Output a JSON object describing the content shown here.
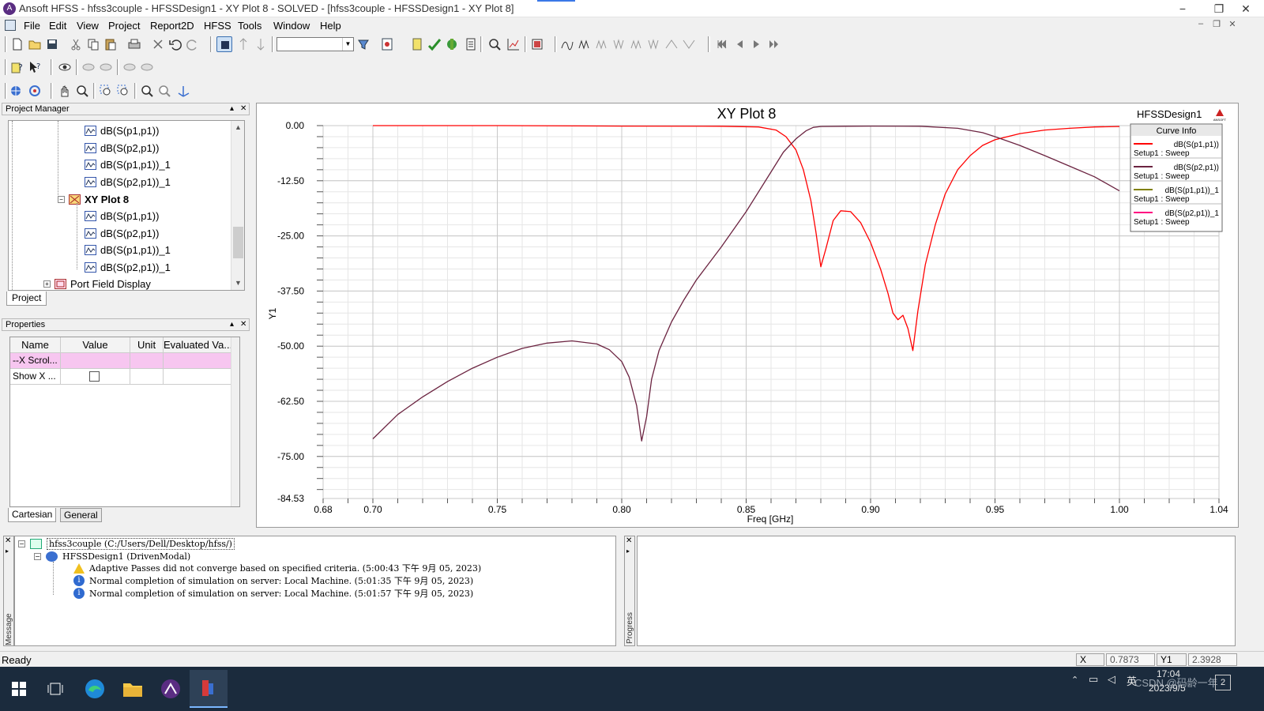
{
  "window": {
    "title": "Ansoft HFSS  - hfss3couple - HFSSDesign1 - XY Plot 8 - SOLVED - [hfss3couple - HFSSDesign1 - XY Plot 8]",
    "controls": [
      "−",
      "❐",
      "✕"
    ]
  },
  "menu": [
    "File",
    "Edit",
    "View",
    "Project",
    "Report2D",
    "HFSS",
    "Tools",
    "Window",
    "Help"
  ],
  "project_manager": {
    "title": "Project Manager",
    "items": [
      {
        "label": "dB(S(p1,p1))",
        "kind": "curve"
      },
      {
        "label": "dB(S(p2,p1))",
        "kind": "curve"
      },
      {
        "label": "dB(S(p1,p1))_1",
        "kind": "curve"
      },
      {
        "label": "dB(S(p2,p1))_1",
        "kind": "curve"
      },
      {
        "label": "XY Plot 8",
        "kind": "plot"
      },
      {
        "label": "dB(S(p1,p1))",
        "kind": "curve"
      },
      {
        "label": "dB(S(p2,p1))",
        "kind": "curve"
      },
      {
        "label": "dB(S(p1,p1))_1",
        "kind": "curve"
      },
      {
        "label": "dB(S(p2,p1))_1",
        "kind": "curve"
      },
      {
        "label": "Port Field Display",
        "kind": "folder"
      }
    ],
    "tab": "Project"
  },
  "properties": {
    "title": "Properties",
    "columns": [
      "Name",
      "Value",
      "Unit",
      "Evaluated Va..."
    ],
    "rows": [
      {
        "name": "--X Scrol...",
        "value": "",
        "unit": "",
        "evaluated": ""
      },
      {
        "name": "Show X ...",
        "value": "",
        "unit": "",
        "evaluated": ""
      }
    ],
    "tabs": [
      "Cartesian",
      "General"
    ]
  },
  "plot": {
    "design_label": "HFSSDesign1",
    "logo_text": "ANSOFT",
    "legend_title": "Curve Info"
  },
  "chart_data": {
    "type": "line",
    "title": "XY Plot 8",
    "xlabel": "Freq [GHz]",
    "ylabel": "Y1",
    "xlim": [
      0.68,
      1.04
    ],
    "ylim": [
      -84.53,
      0.0
    ],
    "x_ticks": [
      "0.68",
      "0.70",
      "0.75",
      "0.80",
      "0.85",
      "0.90",
      "0.95",
      "1.00",
      "1.04"
    ],
    "y_ticks": [
      "0.00",
      "-12.50",
      "-25.00",
      "-37.50",
      "-50.00",
      "-62.50",
      "-75.00",
      "-84.53"
    ],
    "grid": true,
    "legend_position": "top-right",
    "series": [
      {
        "name": "dB(S(p1,p1))",
        "sub": "Setup1 : Sweep",
        "color": "#ff0000",
        "x": [
          0.7,
          0.75,
          0.8,
          0.84,
          0.855,
          0.862,
          0.866,
          0.87,
          0.873,
          0.876,
          0.878,
          0.88,
          0.882,
          0.885,
          0.888,
          0.892,
          0.896,
          0.9,
          0.904,
          0.907,
          0.909,
          0.911,
          0.913,
          0.915,
          0.917,
          0.919,
          0.922,
          0.926,
          0.93,
          0.935,
          0.94,
          0.945,
          0.95,
          0.96,
          0.97,
          0.98,
          0.99,
          1.0
        ],
        "y": [
          0.0,
          0.0,
          -0.1,
          -0.15,
          -0.3,
          -1.0,
          -2.5,
          -5.5,
          -10.0,
          -17.0,
          -24.0,
          -32.0,
          -28.0,
          -21.5,
          -19.3,
          -19.5,
          -22.0,
          -26.5,
          -32.5,
          -38.0,
          -42.5,
          -44.0,
          -43.0,
          -46.0,
          -51.0,
          -42.0,
          -31.5,
          -22.5,
          -15.5,
          -10.0,
          -6.8,
          -4.5,
          -3.2,
          -1.8,
          -1.0,
          -0.6,
          -0.3,
          -0.2
        ]
      },
      {
        "name": "dB(S(p2,p1))",
        "sub": "Setup1 : Sweep",
        "color": "#6b2340",
        "x": [
          0.7,
          0.71,
          0.72,
          0.73,
          0.74,
          0.75,
          0.76,
          0.77,
          0.78,
          0.79,
          0.795,
          0.8,
          0.803,
          0.806,
          0.808,
          0.81,
          0.812,
          0.815,
          0.82,
          0.825,
          0.83,
          0.84,
          0.85,
          0.86,
          0.865,
          0.87,
          0.874,
          0.877,
          0.88,
          0.89,
          0.9,
          0.92,
          0.935,
          0.945,
          0.95,
          0.96,
          0.97,
          0.98,
          0.99,
          1.0
        ],
        "y": [
          -71.0,
          -65.5,
          -61.5,
          -58.0,
          -55.0,
          -52.5,
          -50.5,
          -49.3,
          -48.8,
          -49.5,
          -50.8,
          -53.5,
          -57.0,
          -63.5,
          -71.5,
          -66.0,
          -57.5,
          -51.0,
          -44.5,
          -39.5,
          -35.0,
          -27.5,
          -19.5,
          -10.5,
          -6.0,
          -3.0,
          -1.2,
          -0.4,
          -0.2,
          -0.15,
          -0.1,
          -0.15,
          -0.6,
          -1.6,
          -2.5,
          -4.5,
          -6.8,
          -9.2,
          -11.6,
          -14.8
        ]
      },
      {
        "name": "dB(S(p1,p1))_1",
        "sub": "Setup1 : Sweep",
        "color": "#808000",
        "x": [],
        "y": []
      },
      {
        "name": "dB(S(p2,p1))_1",
        "sub": "Setup1 : Sweep",
        "color": "#ff0080",
        "x": [],
        "y": []
      }
    ]
  },
  "messages": {
    "panel_label": "Message Manager",
    "root": "hfss3couple (C:/Users/Dell/Desktop/hfss/)",
    "design": "HFSSDesign1 (DrivenModal)",
    "entries": [
      {
        "type": "warning",
        "text": "Adaptive Passes did not converge based on specified criteria. (5:00:43 下午  9月 05, 2023)"
      },
      {
        "type": "info",
        "text": "Normal completion of simulation on server: Local Machine. (5:01:35 下午  9月 05, 2023)"
      },
      {
        "type": "info",
        "text": "Normal completion of simulation on server: Local Machine. (5:01:57 下午  9月 05, 2023)"
      }
    ]
  },
  "progress": {
    "panel_label": "Progress"
  },
  "status": {
    "text": "Ready",
    "x_label": "X",
    "x_value": "0.7873",
    "y_label": "Y1",
    "y_value": "2.3928"
  },
  "taskbar": {
    "ime": "英",
    "time": "17:04",
    "date": "2023/9/5",
    "watermark": "CSDN @码龄一年",
    "notification_count": "2"
  }
}
